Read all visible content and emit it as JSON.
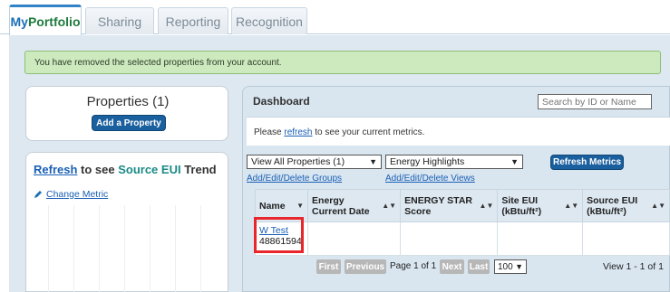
{
  "tabs": [
    {
      "label_a": "My",
      "label_b": "Portfolio"
    },
    {
      "label": "Sharing"
    },
    {
      "label": "Reporting"
    },
    {
      "label": "Recognition"
    }
  ],
  "alert": "You have removed the selected properties from your account.",
  "properties": {
    "title": "Properties (1)",
    "add_button": "Add a Property"
  },
  "trend": {
    "refresh": "Refresh",
    "to_see": " to see ",
    "metric": "Source EUI",
    "trend": " Trend",
    "change_metric": "Change Metric"
  },
  "dashboard": {
    "title": "Dashboard",
    "search_placeholder": "Search by ID or Name",
    "notice_prefix": "Please ",
    "notice_link": "refresh",
    "notice_suffix": " to see your current metrics.",
    "view_select": "View All Properties (1)",
    "metric_select": "Energy Highlights",
    "refresh_button": "Refresh Metrics",
    "link_groups": "Add/Edit/Delete Groups",
    "link_views": "Add/Edit/Delete Views",
    "columns": [
      "Name",
      "Energy Current Date",
      "ENERGY STAR Score",
      "Site EUI (kBtu/ft²)",
      "Source EUI (kBtu/ft²)"
    ],
    "rows": [
      {
        "name": "W Test",
        "id": "48861594",
        "date": "",
        "score": "",
        "site_eui": "",
        "source_eui": ""
      }
    ],
    "pager": {
      "first": "First",
      "previous": "Previous",
      "page_text": "Page 1 of 1",
      "next": "Next",
      "last": "Last",
      "per_page": "100",
      "view_text": "View 1 - 1 of 1"
    }
  },
  "colors": {
    "accent_blue": "#1a5f9e",
    "alert_green": "#cdeabf",
    "highlight_red": "#e8262b"
  }
}
